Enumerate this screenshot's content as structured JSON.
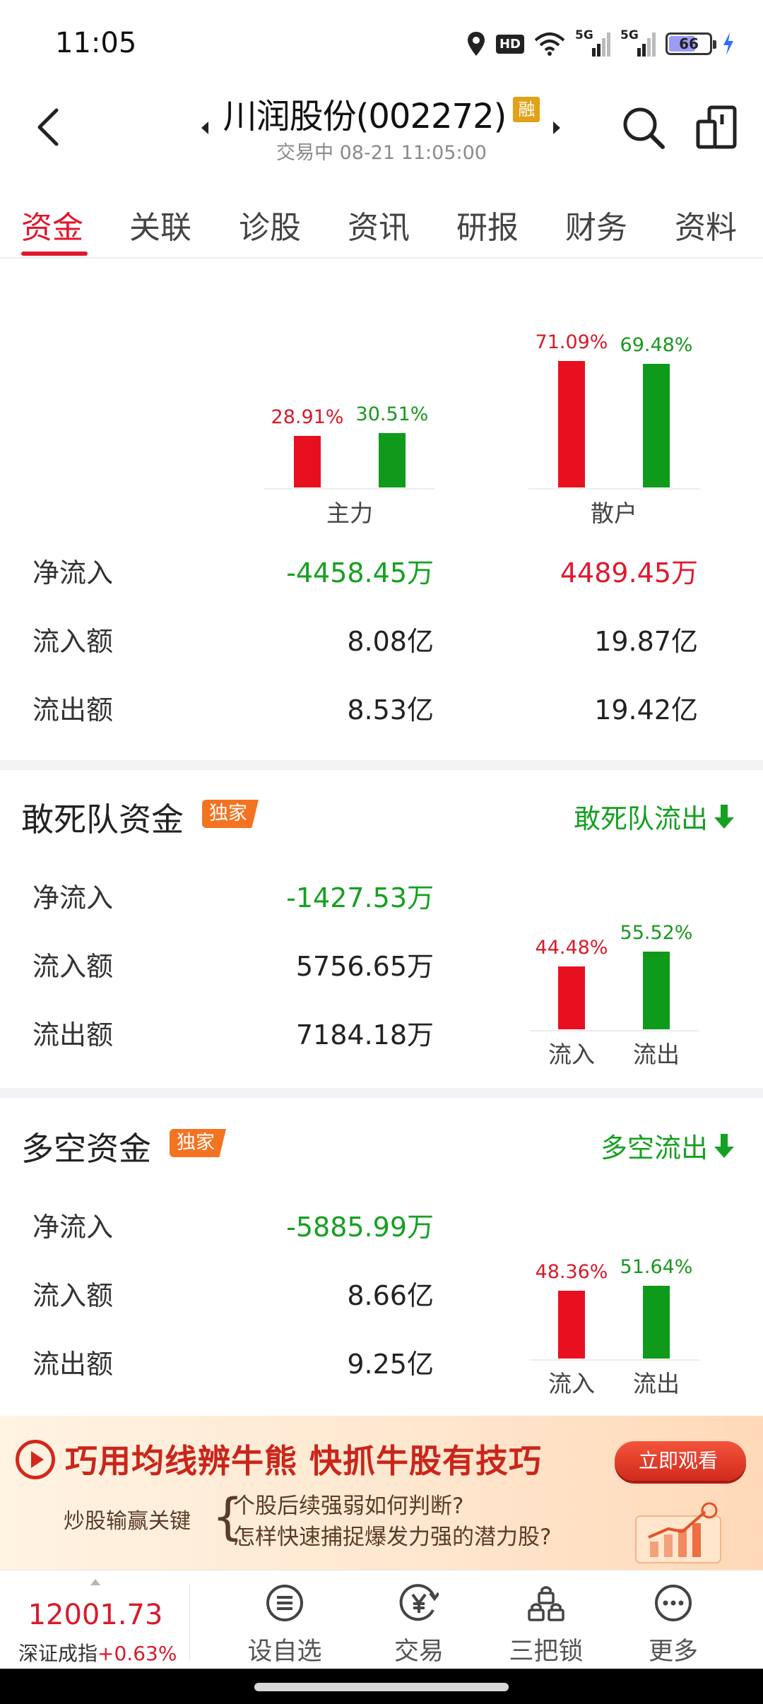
{
  "status_bar": {
    "time": "11:05",
    "icons": [
      "location-icon",
      "hd-icon",
      "wifi-icon",
      "signal-5g-icon",
      "signal-5g-icon",
      "battery-icon",
      "charging-icon"
    ],
    "hd_label": "HD",
    "net1": "5G",
    "net2": "5G",
    "battery": "66",
    "battery_level": 0.66
  },
  "header": {
    "title": "川润股份(002272)",
    "badge": "融",
    "subtitle": "交易中 08-21 11:05:00"
  },
  "tabs": [
    "资金",
    "关联",
    "诊股",
    "资讯",
    "研报",
    "财务",
    "资料"
  ],
  "active_tab": 0,
  "capital_flow": {
    "groups": [
      {
        "name": "主力",
        "in_pct": "28.91%",
        "out_pct": "30.51%",
        "in_val": 28.91,
        "out_val": 30.51
      },
      {
        "name": "散户",
        "in_pct": "71.09%",
        "out_pct": "69.48%",
        "in_val": 71.09,
        "out_val": 69.48
      }
    ],
    "rows": [
      {
        "label": "净流入",
        "values": [
          "-4458.45万",
          "4489.45万"
        ]
      },
      {
        "label": "流入额",
        "values": [
          "8.08亿",
          "19.87亿"
        ]
      },
      {
        "label": "流出额",
        "values": [
          "8.53亿",
          "19.42亿"
        ]
      }
    ]
  },
  "dare_fund": {
    "title": "敢死队资金",
    "badge": "独家",
    "link": "敢死队流出",
    "rows": [
      {
        "label": "净流入",
        "value": "-1427.53万"
      },
      {
        "label": "流入额",
        "value": "5756.65万"
      },
      {
        "label": "流出额",
        "value": "7184.18万"
      }
    ],
    "bars": {
      "in_pct": "44.48%",
      "out_pct": "55.52%",
      "in_val": 44.48,
      "out_val": 55.52,
      "in_label": "流入",
      "out_label": "流出"
    }
  },
  "longshort_fund": {
    "title": "多空资金",
    "badge": "独家",
    "link": "多空流出",
    "rows": [
      {
        "label": "净流入",
        "value": "-5885.99万"
      },
      {
        "label": "流入额",
        "value": "8.66亿"
      },
      {
        "label": "流出额",
        "value": "9.25亿"
      }
    ],
    "bars": {
      "in_pct": "48.36%",
      "out_pct": "51.64%",
      "in_val": 48.36,
      "out_val": 51.64,
      "in_label": "流入",
      "out_label": "流出"
    }
  },
  "ad": {
    "title": "巧用均线辨牛熊  快抓牛股有技巧",
    "button": "立即观看",
    "sub_left": "炒股输赢关键",
    "line1": "个股后续强弱如何判断?",
    "line2": "怎样快速捕捉爆发力强的潜力股?"
  },
  "bottom_bar": {
    "index_value": "12001.73",
    "index_name": "深证成指",
    "index_change": "+0.63%",
    "nav": [
      {
        "label": "设自选",
        "icon": "list-icon"
      },
      {
        "label": "交易",
        "icon": "yuan-icon"
      },
      {
        "label": "三把锁",
        "icon": "locks-icon"
      },
      {
        "label": "更多",
        "icon": "more-icon"
      }
    ]
  },
  "colors": {
    "red": "#e8101e",
    "green": "#109a1b",
    "accent": "#e0192c",
    "badge": "#f47321"
  }
}
